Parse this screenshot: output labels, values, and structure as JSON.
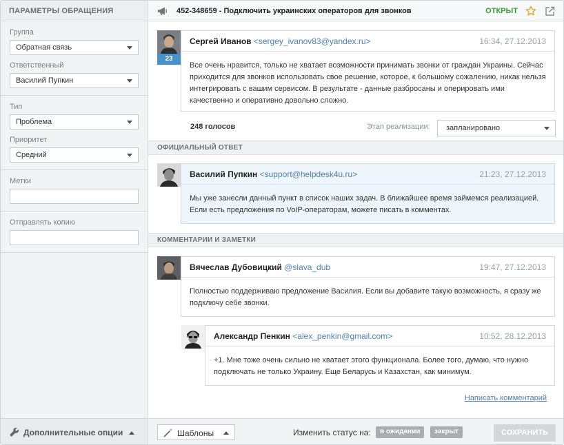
{
  "sidebar": {
    "header": "ПАРАМЕТРЫ ОБРАЩЕНИЯ",
    "group_label": "Группа",
    "group_value": "Обратная связь",
    "assignee_label": "Ответственный",
    "assignee_value": "Василий Пупкин",
    "type_label": "Тип",
    "type_value": "Проблема",
    "priority_label": "Приоритет",
    "priority_value": "Средний",
    "tags_label": "Метки",
    "tags_value": "",
    "cc_label": "Отправлять копию",
    "cc_value": "",
    "footer_label": "Дополнительные опции"
  },
  "topbar": {
    "title": "452-348659 - Подключить украинских операторов для звонков",
    "status": "ОТКРЫТ"
  },
  "ticket": {
    "author": "Сергей Иванов",
    "email": "<sergey_ivanov83@yandex.ru>",
    "time": "16:34, 27.12.2013",
    "votes_badge": "23",
    "body": "Все очень нравится, только не хватает возможности принимать звонки от граждан Украины. Сейчас приходится для звонков использовать свое решение, которое, к большому сожалению, никак нельзя интегрировать с вашим сервисом. В результате - данные разбросаны и оперировать ими качественно и оперативно довольно сложно.",
    "votes_total": "248 голосов",
    "stage_label": "Этап реализации:",
    "stage_value": "запланировано"
  },
  "official": {
    "section_title": "ОФИЦИАЛЬНЫЙ ОТВЕТ",
    "author": "Василий Пупкин",
    "email": "<support@helpdesk4u.ru>",
    "time": "21:23, 27.12.2013",
    "body": "Мы уже занесли данный пункт в список наших задач. В ближайшее время займемся реализацией. Если есть предложения по VoIP-операторам, можете писать в комментах."
  },
  "comments": {
    "section_title": "КОММЕНТАРИИ И ЗАМЕТКИ",
    "items": [
      {
        "author": "Вячеслав Дубовицкий",
        "email": "@slava_dub",
        "time": "19:47, 27.12.2013",
        "body": "Полностью поддерживаю предложение Василия. Если вы добавите такую возможность, я сразу же подключу себе звонки."
      },
      {
        "author": "Александр Пенкин",
        "email": "<alex_penkin@gmail.com>",
        "time": "10:52, 28.12.2013",
        "body": "+1. Мне тоже очень сильно не хватает этого функционала. Более того, думаю, что нужно подключать не только Украину. Еще Беларусь и Казахстан, как минимум."
      }
    ],
    "write_link": "Написать комментарий"
  },
  "bottombar": {
    "templates_label": "Шаблоны",
    "change_status_label": "Изменить статус на:",
    "status_options": [
      "в ожидании",
      "закрыт"
    ],
    "save_label": "СОХРАНИТЬ"
  },
  "colors": {
    "status_open": "#3a9a3a",
    "link": "#4d7fb3",
    "badge": "#4a90c9",
    "official_bg": "#eef5fb"
  },
  "icons": [
    "megaphone-icon",
    "star-icon",
    "external-link-icon",
    "wrench-icon",
    "magic-wand-icon",
    "chevron-down-icon",
    "chevron-up-icon"
  ]
}
